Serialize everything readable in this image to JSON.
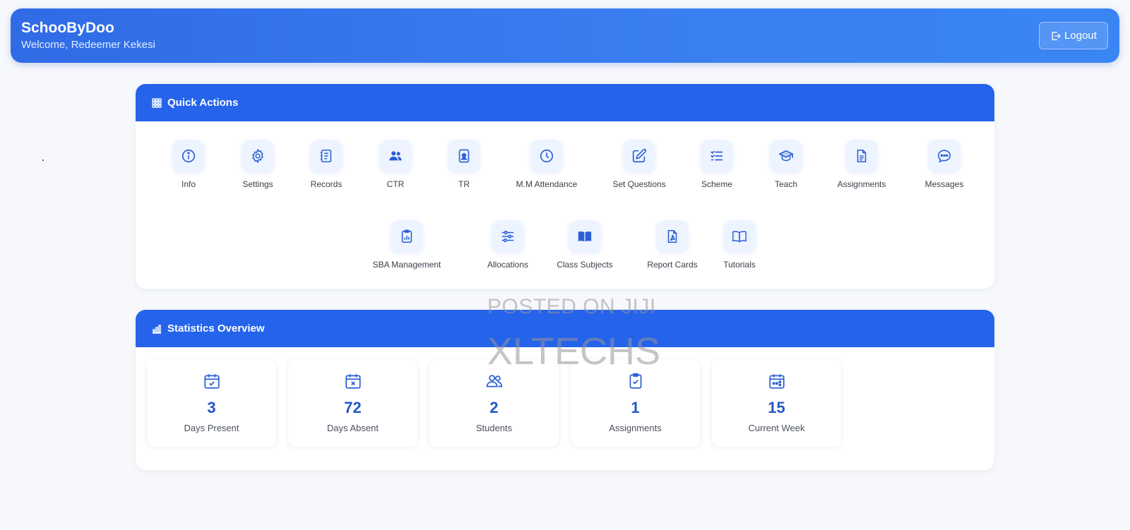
{
  "header": {
    "brand": "SchooByDoo",
    "welcome": "Welcome, Redeemer Kekesi",
    "logout_label": "Logout"
  },
  "quick_actions": {
    "title": "Quick Actions",
    "row1": [
      {
        "label": "Info",
        "icon": "info-icon"
      },
      {
        "label": "Settings",
        "icon": "gear-icon"
      },
      {
        "label": "Records",
        "icon": "records-icon"
      },
      {
        "label": "CTR",
        "icon": "users-icon"
      },
      {
        "label": "TR",
        "icon": "id-badge-icon"
      },
      {
        "label": "M.M Attendance",
        "icon": "clock-icon"
      },
      {
        "label": "Set Questions",
        "icon": "edit-icon"
      },
      {
        "label": "Scheme",
        "icon": "list-check-icon"
      },
      {
        "label": "Teach",
        "icon": "graduation-cap-icon"
      },
      {
        "label": "Assignments",
        "icon": "document-icon"
      },
      {
        "label": "Messages",
        "icon": "chat-icon"
      }
    ],
    "row2": [
      {
        "label": "SBA Management",
        "icon": "clipboard-chart-icon"
      },
      {
        "label": "Allocations",
        "icon": "sliders-icon"
      },
      {
        "label": "Class Subjects",
        "icon": "book-icon"
      },
      {
        "label": "Report Cards",
        "icon": "pdf-file-icon"
      },
      {
        "label": "Tutorials",
        "icon": "open-book-icon"
      }
    ]
  },
  "statistics": {
    "title": "Statistics Overview",
    "items": [
      {
        "value": "3",
        "label": "Days Present",
        "icon": "calendar-check-icon"
      },
      {
        "value": "72",
        "label": "Days Absent",
        "icon": "calendar-x-icon"
      },
      {
        "value": "2",
        "label": "Students",
        "icon": "users-icon"
      },
      {
        "value": "1",
        "label": "Assignments",
        "icon": "clipboard-check-icon"
      },
      {
        "value": "15",
        "label": "Current Week",
        "icon": "calendar-week-icon"
      }
    ]
  },
  "watermark": {
    "line1": "POSTED ON JIJI",
    "line2": "XLTECHS"
  },
  "colors": {
    "primary": "#2563eb",
    "header_gradient_start": "#2f6be6",
    "header_gradient_end": "#3a85f4",
    "page_background": "#f6f8fb",
    "stat_number": "#2557c6"
  }
}
